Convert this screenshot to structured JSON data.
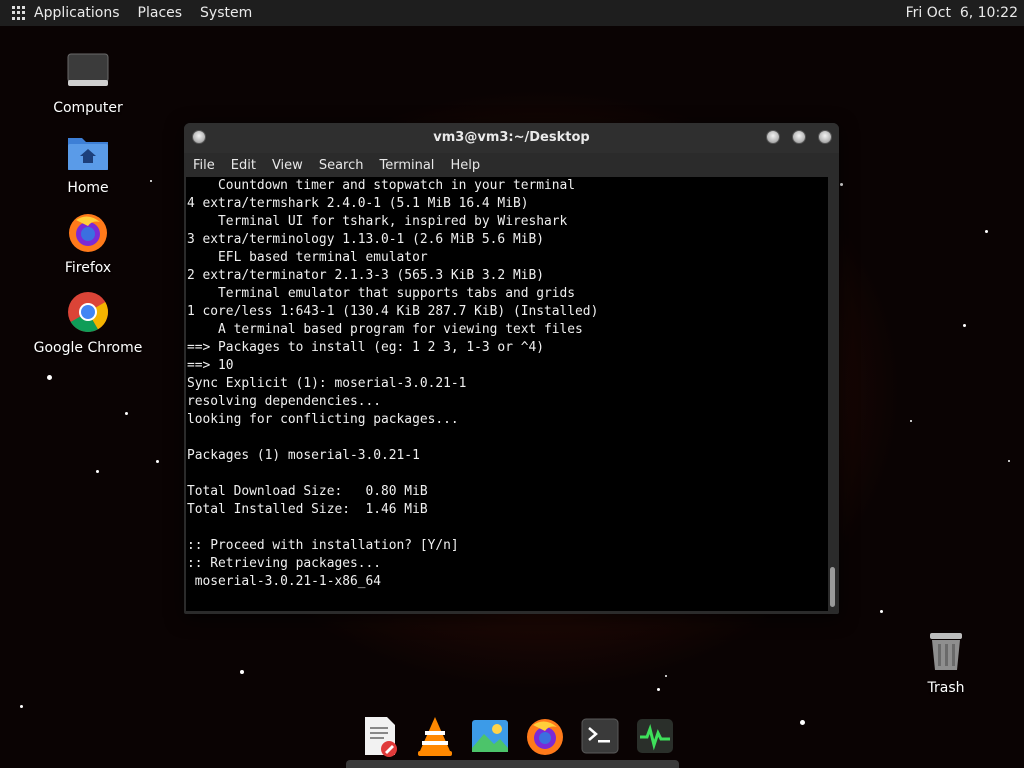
{
  "top_panel": {
    "menus": [
      "Applications",
      "Places",
      "System"
    ],
    "clock": "Fri Oct  6, 10:22"
  },
  "desktop_icons": [
    {
      "label": "Computer",
      "icon": "computer-icon"
    },
    {
      "label": "Home",
      "icon": "home-folder-icon"
    },
    {
      "label": "Firefox",
      "icon": "firefox-icon"
    },
    {
      "label": "Google Chrome",
      "icon": "chrome-icon"
    },
    {
      "label": "Trash",
      "icon": "trash-icon"
    }
  ],
  "window": {
    "title": "vm3@vm3:~/Desktop",
    "menus": [
      "File",
      "Edit",
      "View",
      "Search",
      "Terminal",
      "Help"
    ]
  },
  "terminal": {
    "lines": [
      "    Countdown timer and stopwatch in your terminal",
      "4 extra/termshark 2.4.0-1 (5.1 MiB 16.4 MiB)",
      "    Terminal UI for tshark, inspired by Wireshark",
      "3 extra/terminology 1.13.0-1 (2.6 MiB 5.6 MiB)",
      "    EFL based terminal emulator",
      "2 extra/terminator 2.1.3-3 (565.3 KiB 3.2 MiB)",
      "    Terminal emulator that supports tabs and grids",
      "1 core/less 1:643-1 (130.4 KiB 287.7 KiB) (Installed)",
      "    A terminal based program for viewing text files",
      "==> Packages to install (eg: 1 2 3, 1-3 or ^4)",
      "==> 10",
      "Sync Explicit (1): moserial-3.0.21-1",
      "resolving dependencies...",
      "looking for conflicting packages...",
      "",
      "Packages (1) moserial-3.0.21-1",
      "",
      "Total Download Size:   0.80 MiB",
      "Total Installed Size:  1.46 MiB",
      "",
      ":: Proceed with installation? [Y/n]",
      ":: Retrieving packages...",
      " moserial-3.0.21-1-x86_64"
    ]
  },
  "dock": [
    {
      "icon": "text-editor-icon"
    },
    {
      "icon": "vlc-icon"
    },
    {
      "icon": "image-viewer-icon"
    },
    {
      "icon": "firefox-icon"
    },
    {
      "icon": "terminal-icon"
    },
    {
      "icon": "system-monitor-icon"
    }
  ]
}
